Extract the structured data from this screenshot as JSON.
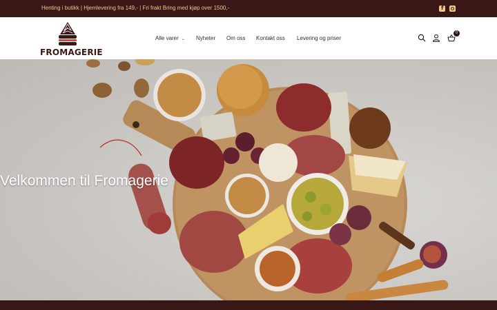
{
  "topbar": {
    "promo_text": "Henting i butikk | Hjemlevering fra 149,- | Fri frakt Bring med kjøp over 1500,-",
    "social_icons": [
      "facebook-icon",
      "instagram-icon"
    ],
    "text_color": "#f0c987",
    "background": "#3a1717"
  },
  "logo": {
    "text": "FROMAGERIE",
    "color": "#3a1717"
  },
  "nav": {
    "items": [
      {
        "label": "Alle varer",
        "has_dropdown": true
      },
      {
        "label": "Nyheter"
      },
      {
        "label": "Om oss"
      },
      {
        "label": "Kontakt oss"
      },
      {
        "label": "Levering og priser"
      }
    ]
  },
  "header_icons": {
    "search": "search-icon",
    "account": "user-icon",
    "cart": "basket-icon",
    "cart_count": "0"
  },
  "hero": {
    "title": "Velkommen til Fromagerie",
    "image": "charcuterie-board-photo"
  }
}
